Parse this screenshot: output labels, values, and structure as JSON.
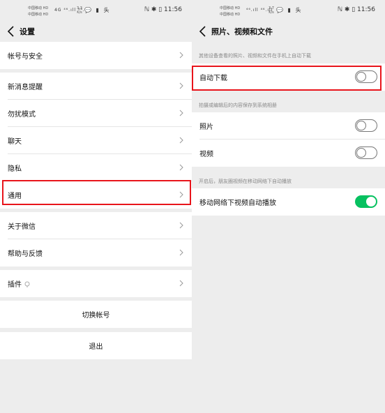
{
  "left": {
    "status": {
      "carrier1": "中国移动 HD",
      "carrier2": "中国移动 HD",
      "network": "4G ⁴⁶.ıll ⁴⁶.ıll",
      "speed_val": "3.3",
      "speed_unit": "K/s",
      "icons": "💬 ▮ 头",
      "right": "ℕ ✱ ▯ 11:56",
      "battery": "80"
    },
    "title": "设置",
    "items": [
      {
        "label": "帐号与安全"
      },
      {
        "label": "新消息提醒"
      },
      {
        "label": "勿扰模式"
      },
      {
        "label": "聊天"
      },
      {
        "label": "隐私"
      },
      {
        "label": "通用"
      },
      {
        "label": "关于微信"
      },
      {
        "label": "帮助与反馈"
      },
      {
        "label": "插件"
      }
    ],
    "switch_account": "切换帐号",
    "logout": "退出"
  },
  "right": {
    "status": {
      "carrier1": "中国移动 HD",
      "carrier2": "中国移动 HD",
      "network": "⁴⁶.ıll ⁴⁶.ıll",
      "speed_val": "3.7",
      "speed_unit": "K/s",
      "icons": "💬 ▮ 头",
      "right": "ℕ ✱ ▯ 11:56",
      "battery": "80"
    },
    "title": "照片、视频和文件",
    "note1": "其他设备查看的照片、视频和文件在手机上自动下载",
    "auto_download": {
      "label": "自动下载",
      "on": false
    },
    "note2": "拍摄或编辑后的内容保存到系统相册",
    "photo": {
      "label": "照片",
      "on": false
    },
    "video": {
      "label": "视频",
      "on": false
    },
    "note3": "开启后，朋友圈视频在移动网络下自动播放",
    "mobile_autoplay": {
      "label": "移动网络下视频自动播放",
      "on": true
    }
  },
  "colors": {
    "highlight": "#e8141b",
    "toggle_on": "#07c160",
    "background": "#ededed"
  }
}
